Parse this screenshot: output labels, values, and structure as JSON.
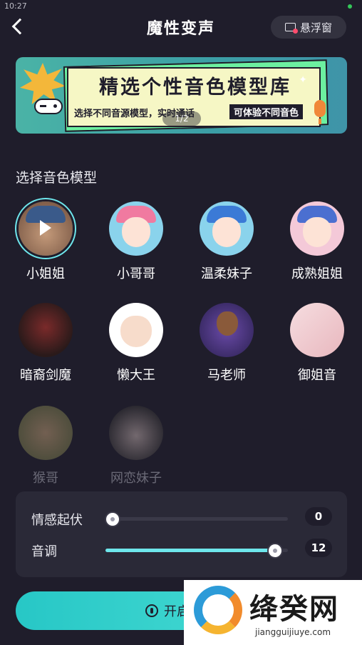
{
  "status": {
    "time": "10:27"
  },
  "header": {
    "title": "魔性变声",
    "float_label": "悬浮窗"
  },
  "banner": {
    "title": "精选个性音色模型库",
    "subtitle": "选择不同音源模型，实时通话",
    "tag": "可体验不同音色",
    "pager": "1/2"
  },
  "section": {
    "title": "选择音色模型"
  },
  "voices": [
    {
      "label": "小姐姐",
      "selected": true,
      "locked": false
    },
    {
      "label": "小哥哥",
      "selected": false,
      "locked": false
    },
    {
      "label": "温柔妹子",
      "selected": false,
      "locked": false
    },
    {
      "label": "成熟姐姐",
      "selected": false,
      "locked": false
    },
    {
      "label": "暗裔剑魔",
      "selected": false,
      "locked": false
    },
    {
      "label": "懒大王",
      "selected": false,
      "locked": false
    },
    {
      "label": "马老师",
      "selected": false,
      "locked": false
    },
    {
      "label": "御姐音",
      "selected": false,
      "locked": false
    },
    {
      "label": "猴哥",
      "selected": false,
      "locked": true
    },
    {
      "label": "网恋妹子",
      "selected": false,
      "locked": true
    }
  ],
  "controls": {
    "emotion": {
      "label": "情感起伏",
      "value": "0",
      "fraction": 0.04
    },
    "pitch": {
      "label": "音调",
      "value": "12",
      "fraction": 0.93
    }
  },
  "start_button": {
    "label": "开启"
  },
  "watermark": {
    "text": "绛癸网",
    "url": "jiangguijiuye.com"
  },
  "colors": {
    "accent": "#6ee6ec",
    "background": "#1f1d2b",
    "panel": "#2a2937"
  }
}
